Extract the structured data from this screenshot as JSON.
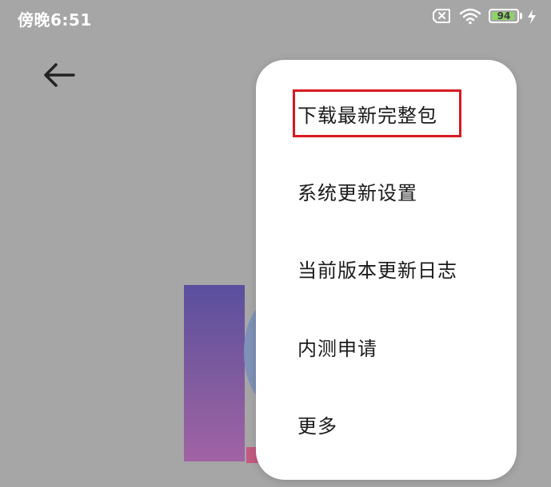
{
  "status_bar": {
    "time": "傍晚6:51",
    "battery_level": "94",
    "battery_color": "#8fd16a",
    "icons": [
      "sim-card-x-icon",
      "wifi-icon",
      "battery-icon",
      "charging-bolt-icon"
    ]
  },
  "header": {
    "back_icon": "arrow-left-icon"
  },
  "menu": {
    "items": [
      {
        "label": "下载最新完整包",
        "highlighted": true
      },
      {
        "label": "系统更新设置"
      },
      {
        "label": "当前版本更新日志"
      },
      {
        "label": "内测申请"
      },
      {
        "label": "更多"
      }
    ],
    "highlight_color": "#d71920"
  }
}
